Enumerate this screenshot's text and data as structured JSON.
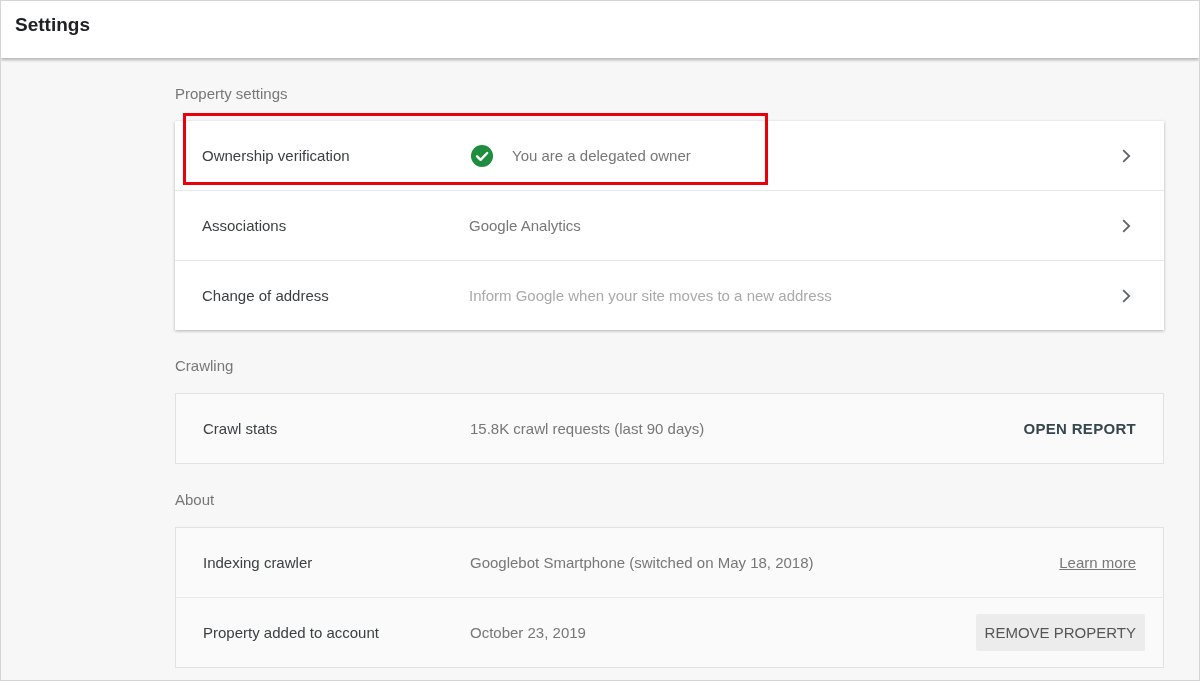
{
  "header": {
    "title": "Settings"
  },
  "sections": [
    {
      "title": "Property settings",
      "kind": "elevated",
      "rows": [
        {
          "label": "Ownership verification",
          "verified": true,
          "value": "You are a delegated owner",
          "dimmed": false,
          "highlighted": true,
          "trail": {
            "kind": "chevron"
          }
        },
        {
          "label": "Associations",
          "verified": false,
          "value": "Google Analytics",
          "dimmed": false,
          "highlighted": false,
          "trail": {
            "kind": "chevron"
          }
        },
        {
          "label": "Change of address",
          "verified": false,
          "value": "Inform Google when your site moves to a new address",
          "dimmed": true,
          "highlighted": false,
          "trail": {
            "kind": "chevron"
          }
        }
      ]
    },
    {
      "title": "Crawling",
      "kind": "outlined",
      "rows": [
        {
          "label": "Crawl stats",
          "verified": false,
          "value": "15.8K crawl requests (last 90 days)",
          "dimmed": false,
          "highlighted": false,
          "trail": {
            "kind": "text-button",
            "label": "OPEN REPORT"
          }
        }
      ]
    },
    {
      "title": "About",
      "kind": "outlined",
      "rows": [
        {
          "label": "Indexing crawler",
          "verified": false,
          "value": "Googlebot Smartphone (switched on May 18, 2018)",
          "dimmed": false,
          "highlighted": false,
          "trail": {
            "kind": "link",
            "label": "Learn more"
          }
        },
        {
          "label": "Property added to account",
          "verified": false,
          "value": "October 23, 2019",
          "dimmed": false,
          "highlighted": false,
          "trail": {
            "kind": "raised-button",
            "label": "REMOVE PROPERTY"
          }
        }
      ]
    }
  ]
}
